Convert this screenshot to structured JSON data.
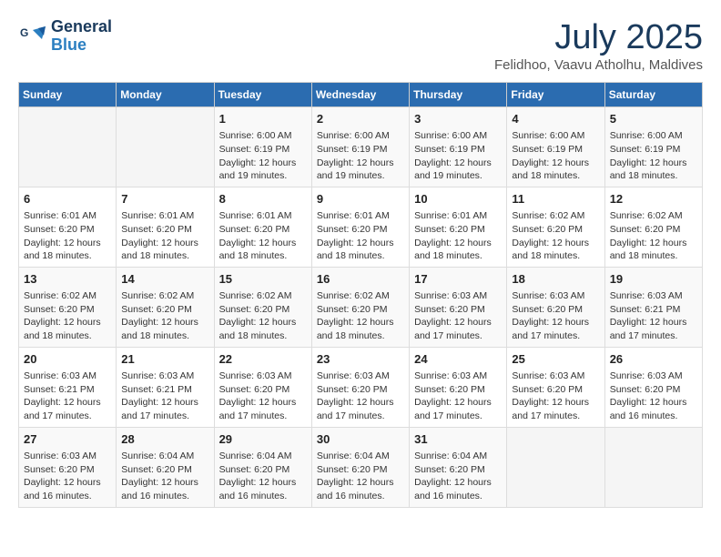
{
  "logo": {
    "line1": "General",
    "line2": "Blue"
  },
  "title": "July 2025",
  "subtitle": "Felidhoo, Vaavu Atholhu, Maldives",
  "weekdays": [
    "Sunday",
    "Monday",
    "Tuesday",
    "Wednesday",
    "Thursday",
    "Friday",
    "Saturday"
  ],
  "weeks": [
    [
      {
        "day": "",
        "info": ""
      },
      {
        "day": "",
        "info": ""
      },
      {
        "day": "1",
        "info": "Sunrise: 6:00 AM\nSunset: 6:19 PM\nDaylight: 12 hours\nand 19 minutes."
      },
      {
        "day": "2",
        "info": "Sunrise: 6:00 AM\nSunset: 6:19 PM\nDaylight: 12 hours\nand 19 minutes."
      },
      {
        "day": "3",
        "info": "Sunrise: 6:00 AM\nSunset: 6:19 PM\nDaylight: 12 hours\nand 19 minutes."
      },
      {
        "day": "4",
        "info": "Sunrise: 6:00 AM\nSunset: 6:19 PM\nDaylight: 12 hours\nand 18 minutes."
      },
      {
        "day": "5",
        "info": "Sunrise: 6:00 AM\nSunset: 6:19 PM\nDaylight: 12 hours\nand 18 minutes."
      }
    ],
    [
      {
        "day": "6",
        "info": "Sunrise: 6:01 AM\nSunset: 6:20 PM\nDaylight: 12 hours\nand 18 minutes."
      },
      {
        "day": "7",
        "info": "Sunrise: 6:01 AM\nSunset: 6:20 PM\nDaylight: 12 hours\nand 18 minutes."
      },
      {
        "day": "8",
        "info": "Sunrise: 6:01 AM\nSunset: 6:20 PM\nDaylight: 12 hours\nand 18 minutes."
      },
      {
        "day": "9",
        "info": "Sunrise: 6:01 AM\nSunset: 6:20 PM\nDaylight: 12 hours\nand 18 minutes."
      },
      {
        "day": "10",
        "info": "Sunrise: 6:01 AM\nSunset: 6:20 PM\nDaylight: 12 hours\nand 18 minutes."
      },
      {
        "day": "11",
        "info": "Sunrise: 6:02 AM\nSunset: 6:20 PM\nDaylight: 12 hours\nand 18 minutes."
      },
      {
        "day": "12",
        "info": "Sunrise: 6:02 AM\nSunset: 6:20 PM\nDaylight: 12 hours\nand 18 minutes."
      }
    ],
    [
      {
        "day": "13",
        "info": "Sunrise: 6:02 AM\nSunset: 6:20 PM\nDaylight: 12 hours\nand 18 minutes."
      },
      {
        "day": "14",
        "info": "Sunrise: 6:02 AM\nSunset: 6:20 PM\nDaylight: 12 hours\nand 18 minutes."
      },
      {
        "day": "15",
        "info": "Sunrise: 6:02 AM\nSunset: 6:20 PM\nDaylight: 12 hours\nand 18 minutes."
      },
      {
        "day": "16",
        "info": "Sunrise: 6:02 AM\nSunset: 6:20 PM\nDaylight: 12 hours\nand 18 minutes."
      },
      {
        "day": "17",
        "info": "Sunrise: 6:03 AM\nSunset: 6:20 PM\nDaylight: 12 hours\nand 17 minutes."
      },
      {
        "day": "18",
        "info": "Sunrise: 6:03 AM\nSunset: 6:20 PM\nDaylight: 12 hours\nand 17 minutes."
      },
      {
        "day": "19",
        "info": "Sunrise: 6:03 AM\nSunset: 6:21 PM\nDaylight: 12 hours\nand 17 minutes."
      }
    ],
    [
      {
        "day": "20",
        "info": "Sunrise: 6:03 AM\nSunset: 6:21 PM\nDaylight: 12 hours\nand 17 minutes."
      },
      {
        "day": "21",
        "info": "Sunrise: 6:03 AM\nSunset: 6:21 PM\nDaylight: 12 hours\nand 17 minutes."
      },
      {
        "day": "22",
        "info": "Sunrise: 6:03 AM\nSunset: 6:20 PM\nDaylight: 12 hours\nand 17 minutes."
      },
      {
        "day": "23",
        "info": "Sunrise: 6:03 AM\nSunset: 6:20 PM\nDaylight: 12 hours\nand 17 minutes."
      },
      {
        "day": "24",
        "info": "Sunrise: 6:03 AM\nSunset: 6:20 PM\nDaylight: 12 hours\nand 17 minutes."
      },
      {
        "day": "25",
        "info": "Sunrise: 6:03 AM\nSunset: 6:20 PM\nDaylight: 12 hours\nand 17 minutes."
      },
      {
        "day": "26",
        "info": "Sunrise: 6:03 AM\nSunset: 6:20 PM\nDaylight: 12 hours\nand 16 minutes."
      }
    ],
    [
      {
        "day": "27",
        "info": "Sunrise: 6:03 AM\nSunset: 6:20 PM\nDaylight: 12 hours\nand 16 minutes."
      },
      {
        "day": "28",
        "info": "Sunrise: 6:04 AM\nSunset: 6:20 PM\nDaylight: 12 hours\nand 16 minutes."
      },
      {
        "day": "29",
        "info": "Sunrise: 6:04 AM\nSunset: 6:20 PM\nDaylight: 12 hours\nand 16 minutes."
      },
      {
        "day": "30",
        "info": "Sunrise: 6:04 AM\nSunset: 6:20 PM\nDaylight: 12 hours\nand 16 minutes."
      },
      {
        "day": "31",
        "info": "Sunrise: 6:04 AM\nSunset: 6:20 PM\nDaylight: 12 hours\nand 16 minutes."
      },
      {
        "day": "",
        "info": ""
      },
      {
        "day": "",
        "info": ""
      }
    ]
  ]
}
